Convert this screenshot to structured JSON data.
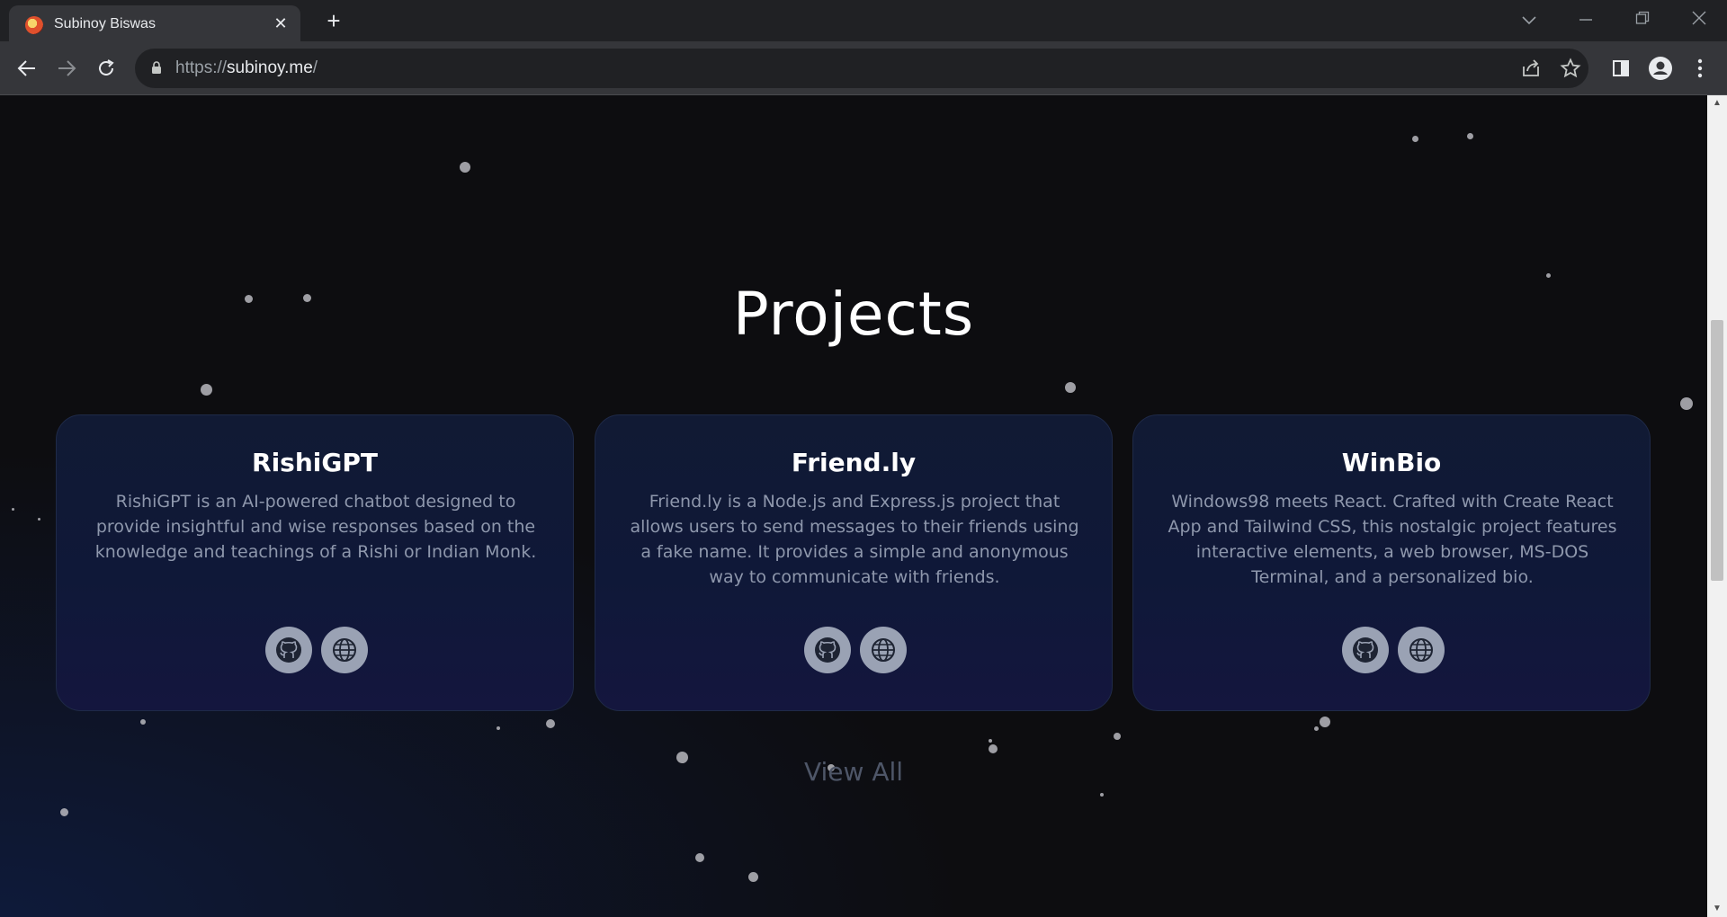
{
  "browser": {
    "tab_title": "Subinoy Biswas",
    "tab_close": "✕",
    "new_tab": "+",
    "url_scheme": "https://",
    "url_host": "subinoy.me",
    "url_path": "/"
  },
  "page": {
    "heading": "Projects",
    "projects": [
      {
        "title": "RishiGPT",
        "description": "RishiGPT is an AI-powered chatbot designed to provide insightful and wise responses based on the knowledge and teachings of a Rishi or Indian Monk."
      },
      {
        "title": "Friend.ly",
        "description": "Friend.ly is a Node.js and Express.js project that allows users to send messages to their friends using a fake name. It provides a simple and anonymous way to communicate with friends."
      },
      {
        "title": "WinBio",
        "description": "Windows98 meets React. Crafted with Create React App and Tailwind CSS, this nostalgic project features interactive elements, a web browser, MS-DOS Terminal, and a personalized bio."
      }
    ],
    "view_all": "View All"
  },
  "icons": {
    "github": "github-icon",
    "website": "globe-icon"
  },
  "colors": {
    "background": "#0d0d10",
    "card": "#111a34",
    "accent_icon": "#9aa2b4"
  }
}
